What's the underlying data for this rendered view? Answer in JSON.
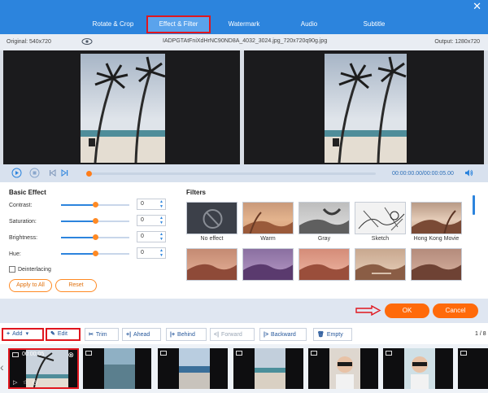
{
  "tabs": [
    {
      "label": "Rotate & Crop",
      "active": false
    },
    {
      "label": "Effect & Filter",
      "active": true
    },
    {
      "label": "Watermark",
      "active": false
    },
    {
      "label": "Audio",
      "active": false
    },
    {
      "label": "Subtitle",
      "active": false
    }
  ],
  "info": {
    "original": "Original: 540x720",
    "filename": "IADPGTAtFniXdHrNC90ND8A_4032_3024.jpg_720x720q90g.jpg",
    "output": "Output: 1280x720"
  },
  "player": {
    "timecode": "00:00:00.00/00:00:05.00",
    "progress": 0
  },
  "basic_effect": {
    "title": "Basic Effect",
    "rows": [
      {
        "label": "Contrast:",
        "value": "0",
        "level": 0.5
      },
      {
        "label": "Saturation:",
        "value": "0",
        "level": 0.5
      },
      {
        "label": "Brightness:",
        "value": "0",
        "level": 0.5
      },
      {
        "label": "Hue:",
        "value": "0",
        "level": 0.5
      }
    ],
    "deinterlacing": "Deinterlacing",
    "apply_all": "Apply to All",
    "reset": "Reset"
  },
  "filters": {
    "title": "Filters",
    "items": [
      {
        "label": "No effect"
      },
      {
        "label": "Warm"
      },
      {
        "label": "Gray"
      },
      {
        "label": "Sketch"
      },
      {
        "label": "Hong Kong Movie"
      },
      {
        "label": ""
      },
      {
        "label": ""
      },
      {
        "label": ""
      },
      {
        "label": ""
      },
      {
        "label": ""
      }
    ]
  },
  "actions": {
    "ok": "OK",
    "cancel": "Cancel"
  },
  "toolbar": {
    "add": "Add",
    "edit": "Edit",
    "trim": "Trim",
    "ahead": "Ahead",
    "behind": "Behind",
    "forward": "Forward",
    "backward": "Backward",
    "empty": "Empty",
    "pager": "1 / 8"
  },
  "clips": [
    {
      "time": "00:00:05"
    }
  ],
  "colors": {
    "accent_blue": "#2c84dd",
    "accent_orange": "#ff6a0a",
    "highlight_red": "#e0161e"
  }
}
